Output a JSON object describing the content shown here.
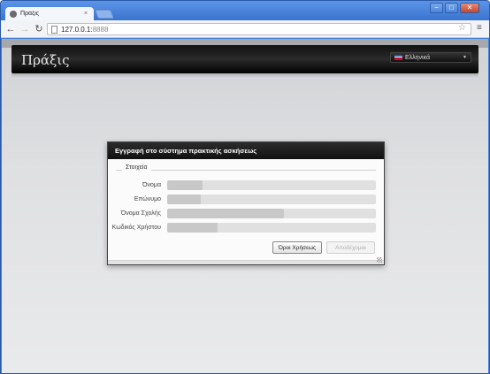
{
  "browser": {
    "tab_title": "Πράξις",
    "tab_close": "×",
    "url_host": "127.0.0.1:",
    "url_port": "8888",
    "controls": {
      "minimize": "−",
      "maximize": "□",
      "close": "✕"
    },
    "icons": {
      "back": "back-arrow-icon",
      "forward": "forward-arrow-icon",
      "reload": "reload-icon",
      "star": "star-icon",
      "wrench": "wrench-icon"
    }
  },
  "app": {
    "brand": "Πράξις",
    "language": {
      "selected": "Ελληνικά",
      "flag": "greek-flag-icon"
    }
  },
  "dialog": {
    "title": "Εγγραφή στο σύστημα πρακτικής ασκήσεως",
    "legend": "Στοιχεία",
    "fields": [
      {
        "label": "Όνομα",
        "fill": 0.17
      },
      {
        "label": "Επώνυμο",
        "fill": 0.16
      },
      {
        "label": "Όνομα Σχολής",
        "fill": 0.56
      },
      {
        "label": "Κωδικός Χρήστου",
        "fill": 0.24
      }
    ],
    "buttons": {
      "terms": "Όροι Χρήσεως",
      "accept": "Αποδέχομαι"
    }
  }
}
